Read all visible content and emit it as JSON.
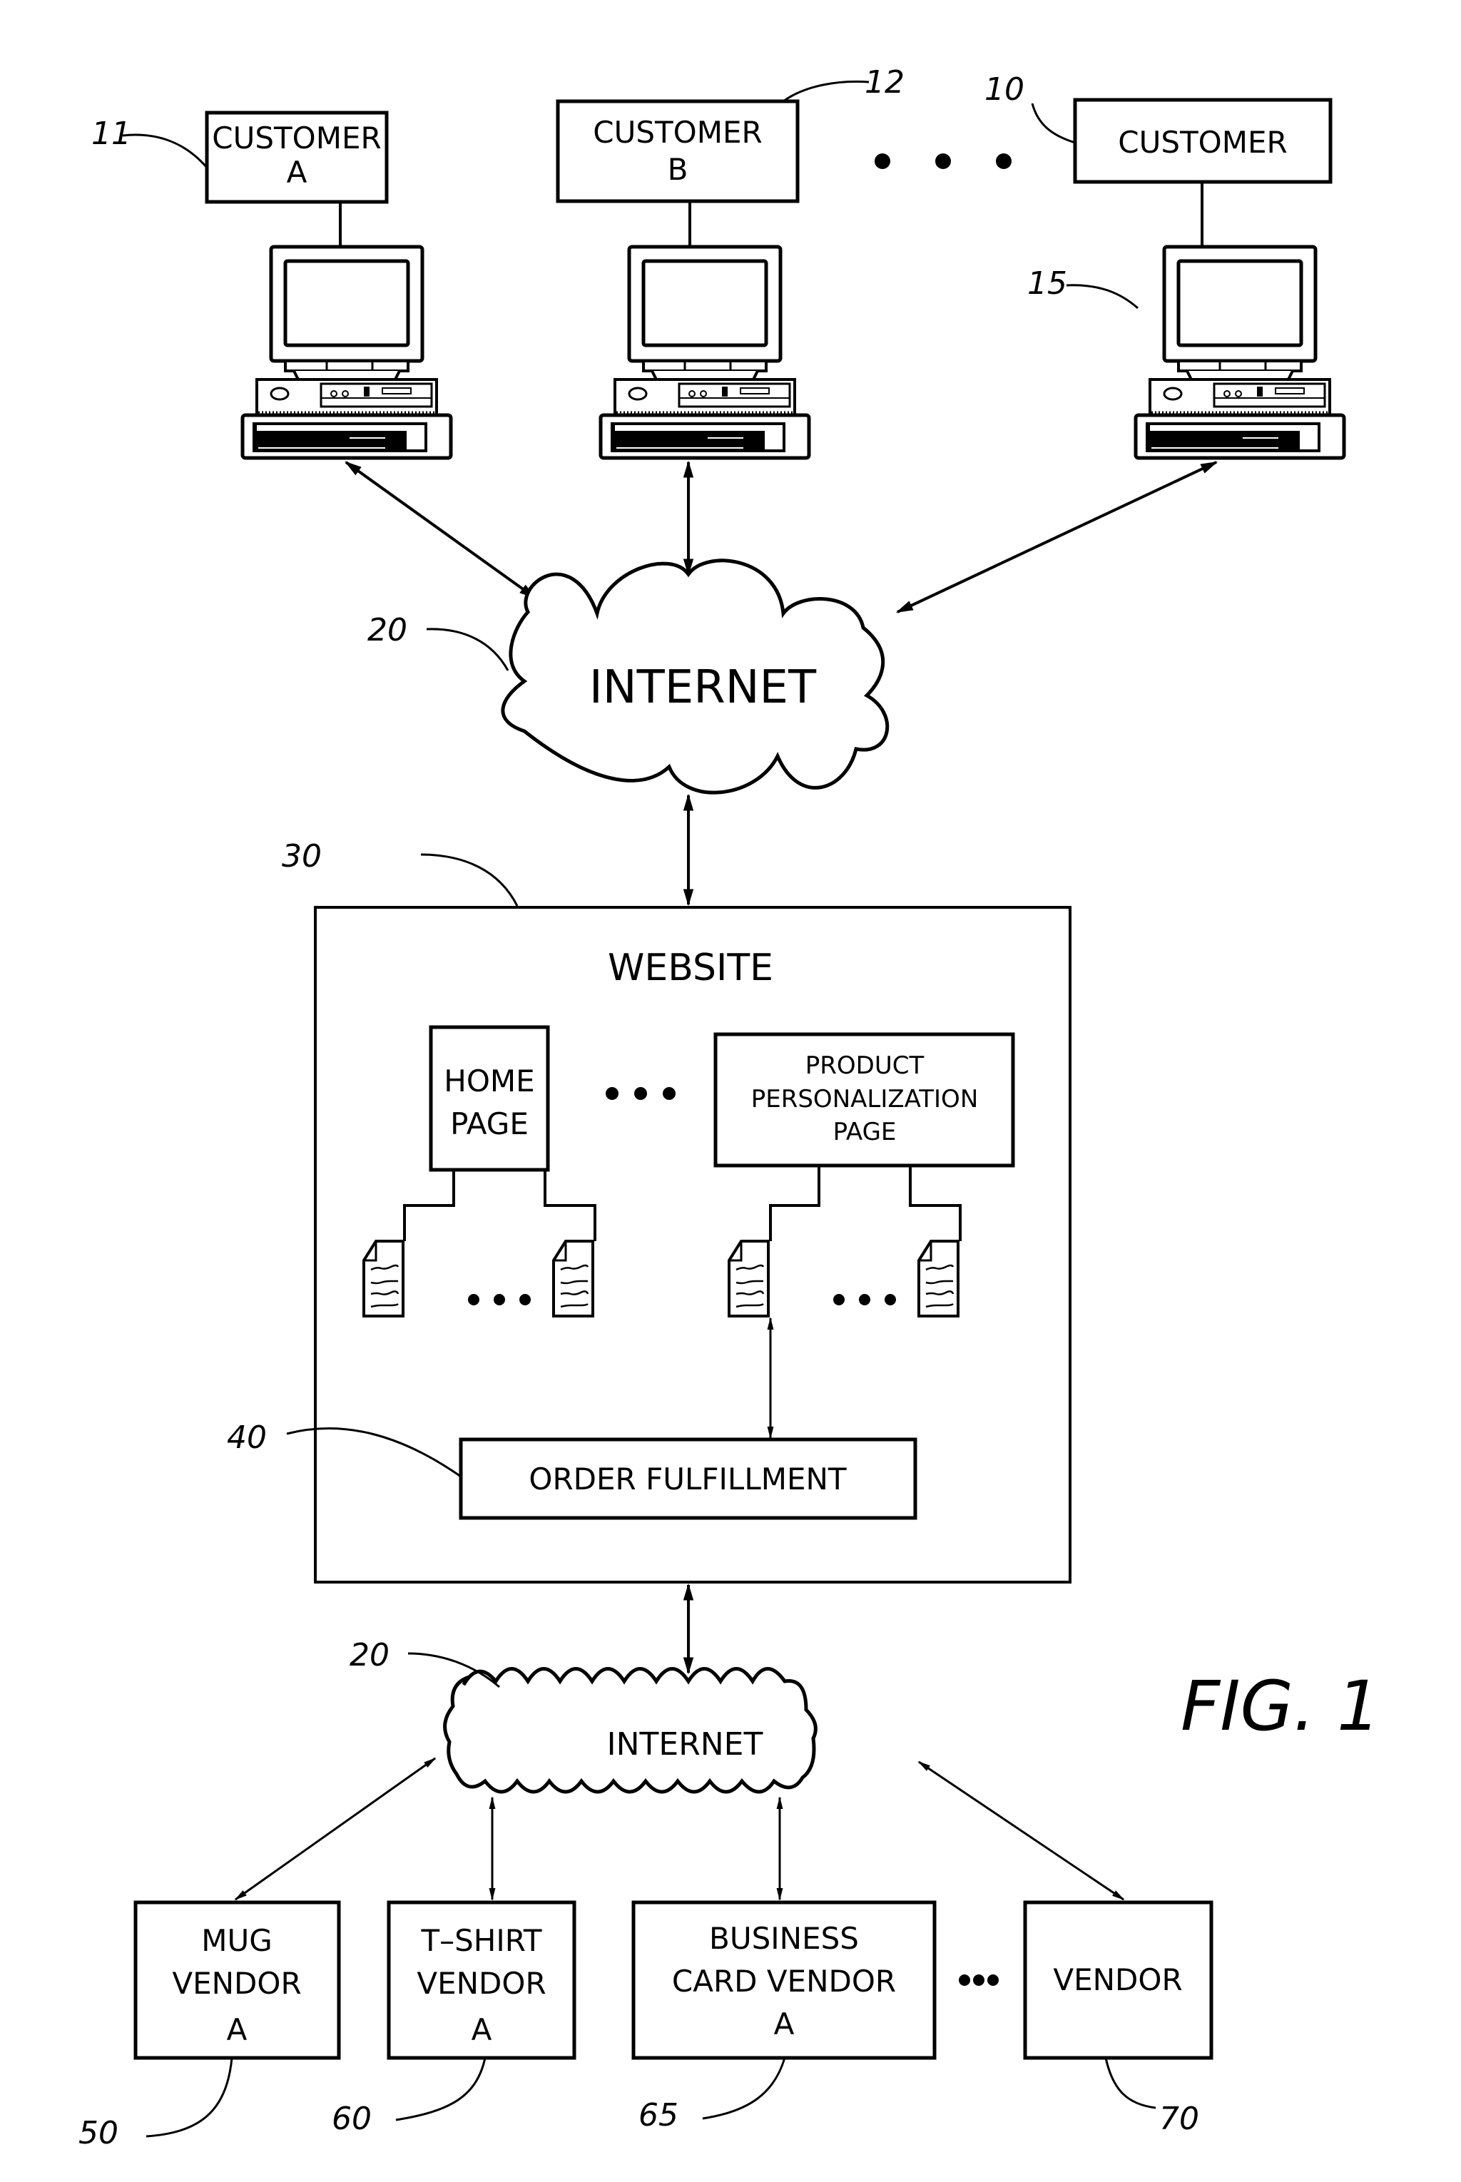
{
  "figure": {
    "caption": "FIG. 1"
  },
  "customers": [
    {
      "line1": "CUSTOMER",
      "line2": "A",
      "ref": "11"
    },
    {
      "line1": "CUSTOMER",
      "line2": "B",
      "ref": "12"
    },
    {
      "line1": "CUSTOMER",
      "line2": "",
      "ref": "10"
    }
  ],
  "computer": {
    "ref": "15"
  },
  "internet_top": {
    "label": "INTERNET",
    "ref": "20"
  },
  "website": {
    "title": "WEBSITE",
    "ref": "30",
    "home_page": {
      "line1": "HOME",
      "line2": "PAGE"
    },
    "product_page": {
      "line1": "PRODUCT",
      "line2": "PERSONALIZATION",
      "line3": "PAGE"
    },
    "order_fulfillment": {
      "label": "ORDER  FULFILLMENT",
      "ref": "40"
    }
  },
  "internet_bottom": {
    "label": "INTERNET",
    "ref": "20"
  },
  "vendors": [
    {
      "line1": "MUG",
      "line2": "VENDOR",
      "line3": "A",
      "ref": "50"
    },
    {
      "line1": "T–SHIRT",
      "line2": "VENDOR",
      "line3": "A",
      "ref": "60"
    },
    {
      "line1": "BUSINESS",
      "line2": "CARD  VENDOR",
      "line3": "A",
      "ref": "65"
    },
    {
      "line1": "VENDOR",
      "line2": "",
      "line3": "",
      "ref": "70"
    }
  ]
}
